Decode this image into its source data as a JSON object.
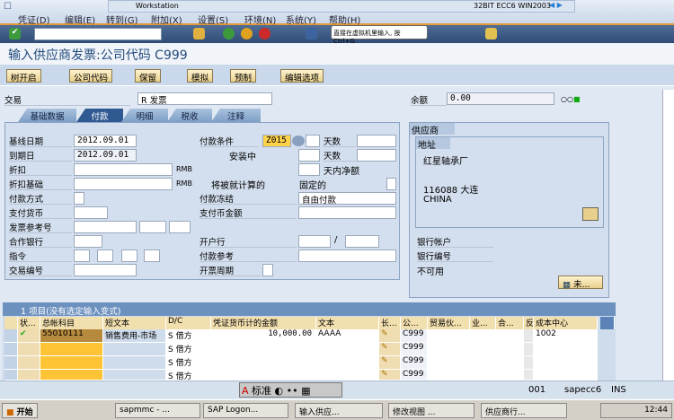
{
  "vmware": {
    "workstation": "Workstation",
    "vm_name": "32BIT ECC6 WIN2003",
    "tooltip": "直接在虚拟机里输入, 按 Ctrl+G."
  },
  "menu": [
    "凭证(D)",
    "编辑(E)",
    "转到(G)",
    "附加(X)",
    "设置(S)",
    "环境(N)",
    "系统(Y)",
    "帮助(H)"
  ],
  "command_field": "",
  "title": "输入供应商发票:公司代码 C999",
  "app_toolbar": [
    "树开启",
    "公司代码",
    "保留",
    "模拟",
    "预制",
    "编辑选项"
  ],
  "header": {
    "trans_label": "交易",
    "trans_value": "R 发票",
    "balance_label": "余额",
    "balance_value": "0.00"
  },
  "tabs": [
    "基础数据",
    "付款",
    "明细",
    "税收",
    "注释"
  ],
  "active_tab": "付款",
  "form": {
    "baseline_date": {
      "label": "基线日期",
      "value": "2012.09.01"
    },
    "due_date": {
      "label": "到期日",
      "value": "2012.09.01"
    },
    "discount": {
      "label": "折扣",
      "unit": "RMB"
    },
    "discount_base": {
      "label": "折扣基础",
      "unit": "RMB"
    },
    "pay_method": {
      "label": "付款方式"
    },
    "pay_currency": {
      "label": "支付货币"
    },
    "invoice_ref": {
      "label": "发票参考号"
    },
    "partner_bank": {
      "label": "合作银行"
    },
    "instruction": {
      "label": "指令"
    },
    "trans_no": {
      "label": "交易编号"
    },
    "pay_terms": {
      "label": "付款条件",
      "value": "Z015"
    },
    "days1": "天数",
    "days2": "天数",
    "net_days": "天内净额",
    "installment": "安装中",
    "calculated": "将被就计算的",
    "fixed": "固定的",
    "pay_block": {
      "label": "付款冻结",
      "value": "自由付款"
    },
    "pay_amount": {
      "label": "支付币金额"
    },
    "house_bank": {
      "label": "开户行",
      "sep": "/"
    },
    "pay_ref": {
      "label": "付款参考"
    },
    "invoice_period": {
      "label": "开票周期"
    }
  },
  "vendor": {
    "title": "供应商",
    "address_title": "地址",
    "name": "红星轴承厂",
    "city": "116088 大连",
    "country": "CHINA",
    "bank_account": "银行帐户",
    "bank_number": "银行编号",
    "not_available": "不可用",
    "more_button": "未..."
  },
  "table": {
    "caption": "1 项目(没有选定输入变式)",
    "columns": [
      "状...",
      "总帐科目",
      "短文本",
      "D/C",
      "凭证货币计的金额",
      "文本",
      "长...",
      "公...",
      "贸易伙...",
      "业...",
      "合...",
      "反...",
      "成本中心"
    ],
    "rows": [
      {
        "account": "55010111",
        "short_text": "销售费用-市场",
        "dc": "S 借方",
        "amount": "10,000.00",
        "text": "AAAA",
        "company": "C999",
        "cost_center": "1002"
      },
      {
        "dc": "S 借方",
        "company": "C999"
      },
      {
        "dc": "S 借方",
        "company": "C999"
      },
      {
        "dc": "S 借方",
        "company": "C999"
      }
    ]
  },
  "statusbar": {
    "ime": "标准",
    "client": "001",
    "server": "sapecc6",
    "mode": "INS"
  },
  "taskbar": {
    "start": "开始",
    "items": [
      "sapmmc - ...",
      "SAP Logon...",
      "输入供应...",
      "修改视图 ...",
      "供应商行..."
    ],
    "clock": "12:44"
  }
}
